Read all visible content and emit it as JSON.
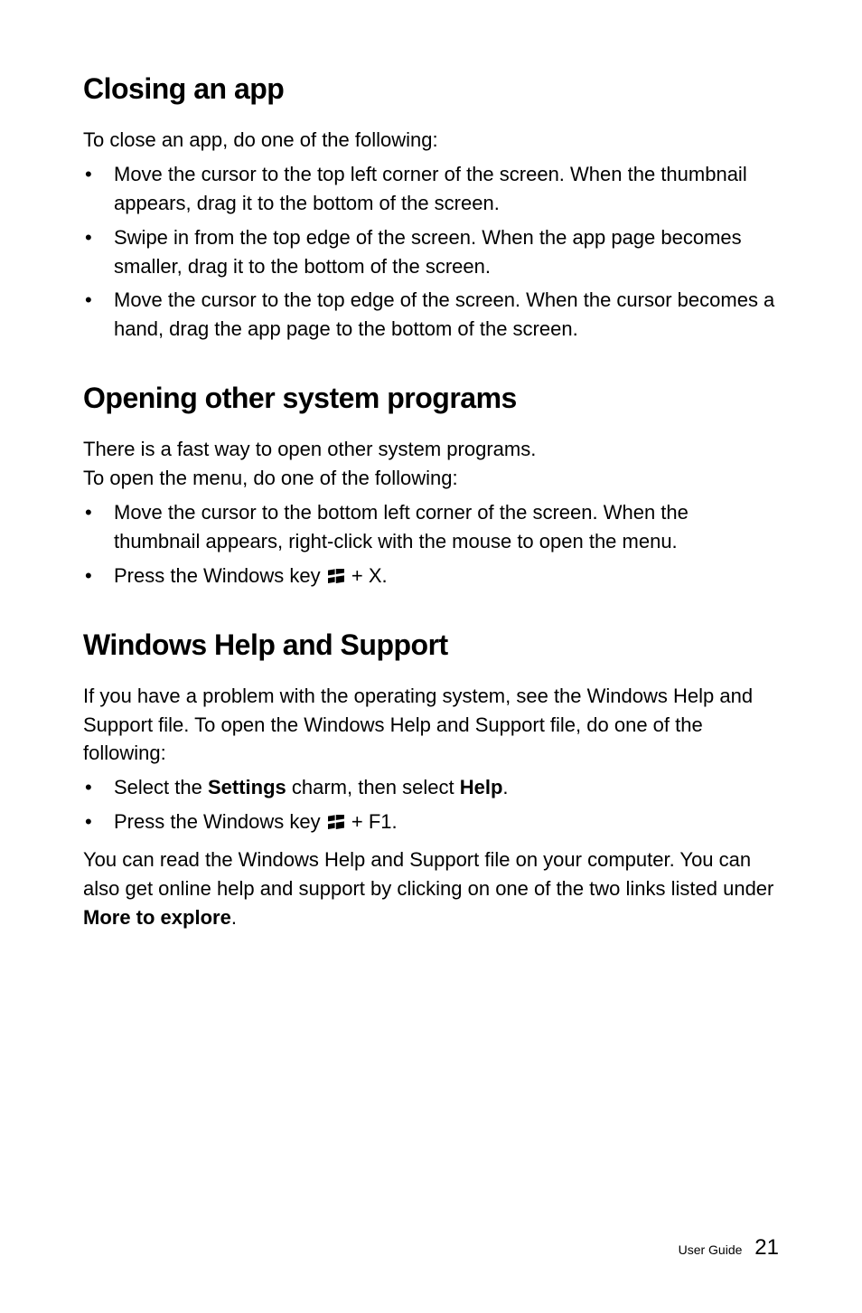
{
  "sections": {
    "closing": {
      "heading": "Closing an app",
      "intro": "To close an app, do one of the following:",
      "bullets": [
        "Move the cursor to the top left corner of the screen. When the thumbnail appears, drag it to the bottom of the screen.",
        "Swipe in from the top edge of the screen. When the app page becomes smaller, drag it to the bottom of the screen.",
        "Move the cursor to the top edge of the screen. When the cursor becomes a hand, drag the app page to the bottom of the screen."
      ]
    },
    "opening": {
      "heading": "Opening other system programs",
      "intro1": "There is a fast way to open other system programs.",
      "intro2": "To open the menu, do one of the following:",
      "bullet1": "Move the cursor to the bottom left corner of the screen. When the thumbnail appears, right-click with the mouse to open the menu.",
      "bullet2_pre": "Press the Windows key ",
      "bullet2_post": " + X."
    },
    "help": {
      "heading": "Windows Help and Support",
      "intro": "If you have a problem with the operating system, see the Windows Help and Support file. To open the Windows Help and Support file, do one of the following:",
      "bullet1_pre": "Select the ",
      "bullet1_settings": "Settings",
      "bullet1_mid": " charm, then select ",
      "bullet1_help": "Help",
      "bullet1_post": ".",
      "bullet2_pre": "Press the Windows key ",
      "bullet2_post": " + F1.",
      "after_pre": "You can read the Windows Help and Support file on your computer. You can also get online help and support by clicking on one of the two links listed under ",
      "after_bold": "More to explore",
      "after_post": "."
    }
  },
  "footer": {
    "label": "User Guide",
    "page": "21"
  }
}
